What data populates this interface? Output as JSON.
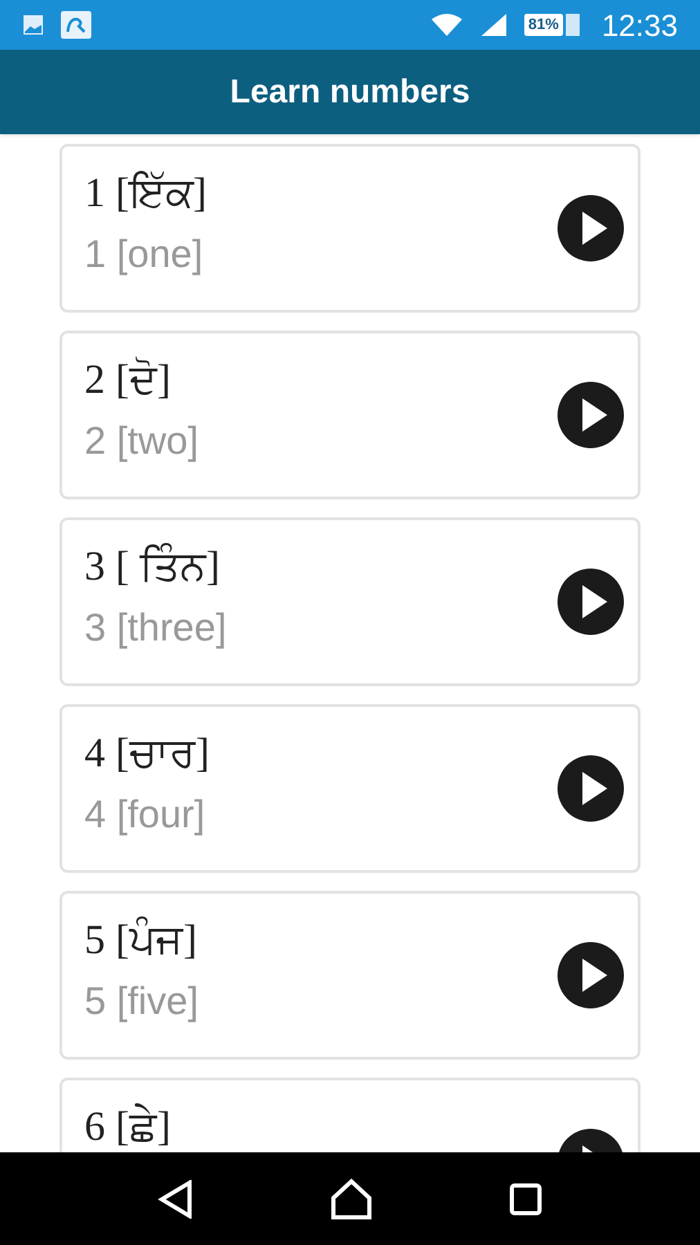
{
  "status_bar": {
    "battery": "81%",
    "time": "12:33"
  },
  "app_bar": {
    "title": "Learn numbers"
  },
  "items": [
    {
      "native": "1 [ਇੱਕ]",
      "english": "1 [one]"
    },
    {
      "native": "2 [ਦੋ]",
      "english": "2 [two]"
    },
    {
      "native": "3 [ ਤਿੰਨ]",
      "english": "3 [three]"
    },
    {
      "native": "4 [ਚਾਰ]",
      "english": "4 [four]"
    },
    {
      "native": "5 [ਪੰਜ]",
      "english": "5 [five]"
    },
    {
      "native": "6 [ਛੇ]"
    }
  ]
}
